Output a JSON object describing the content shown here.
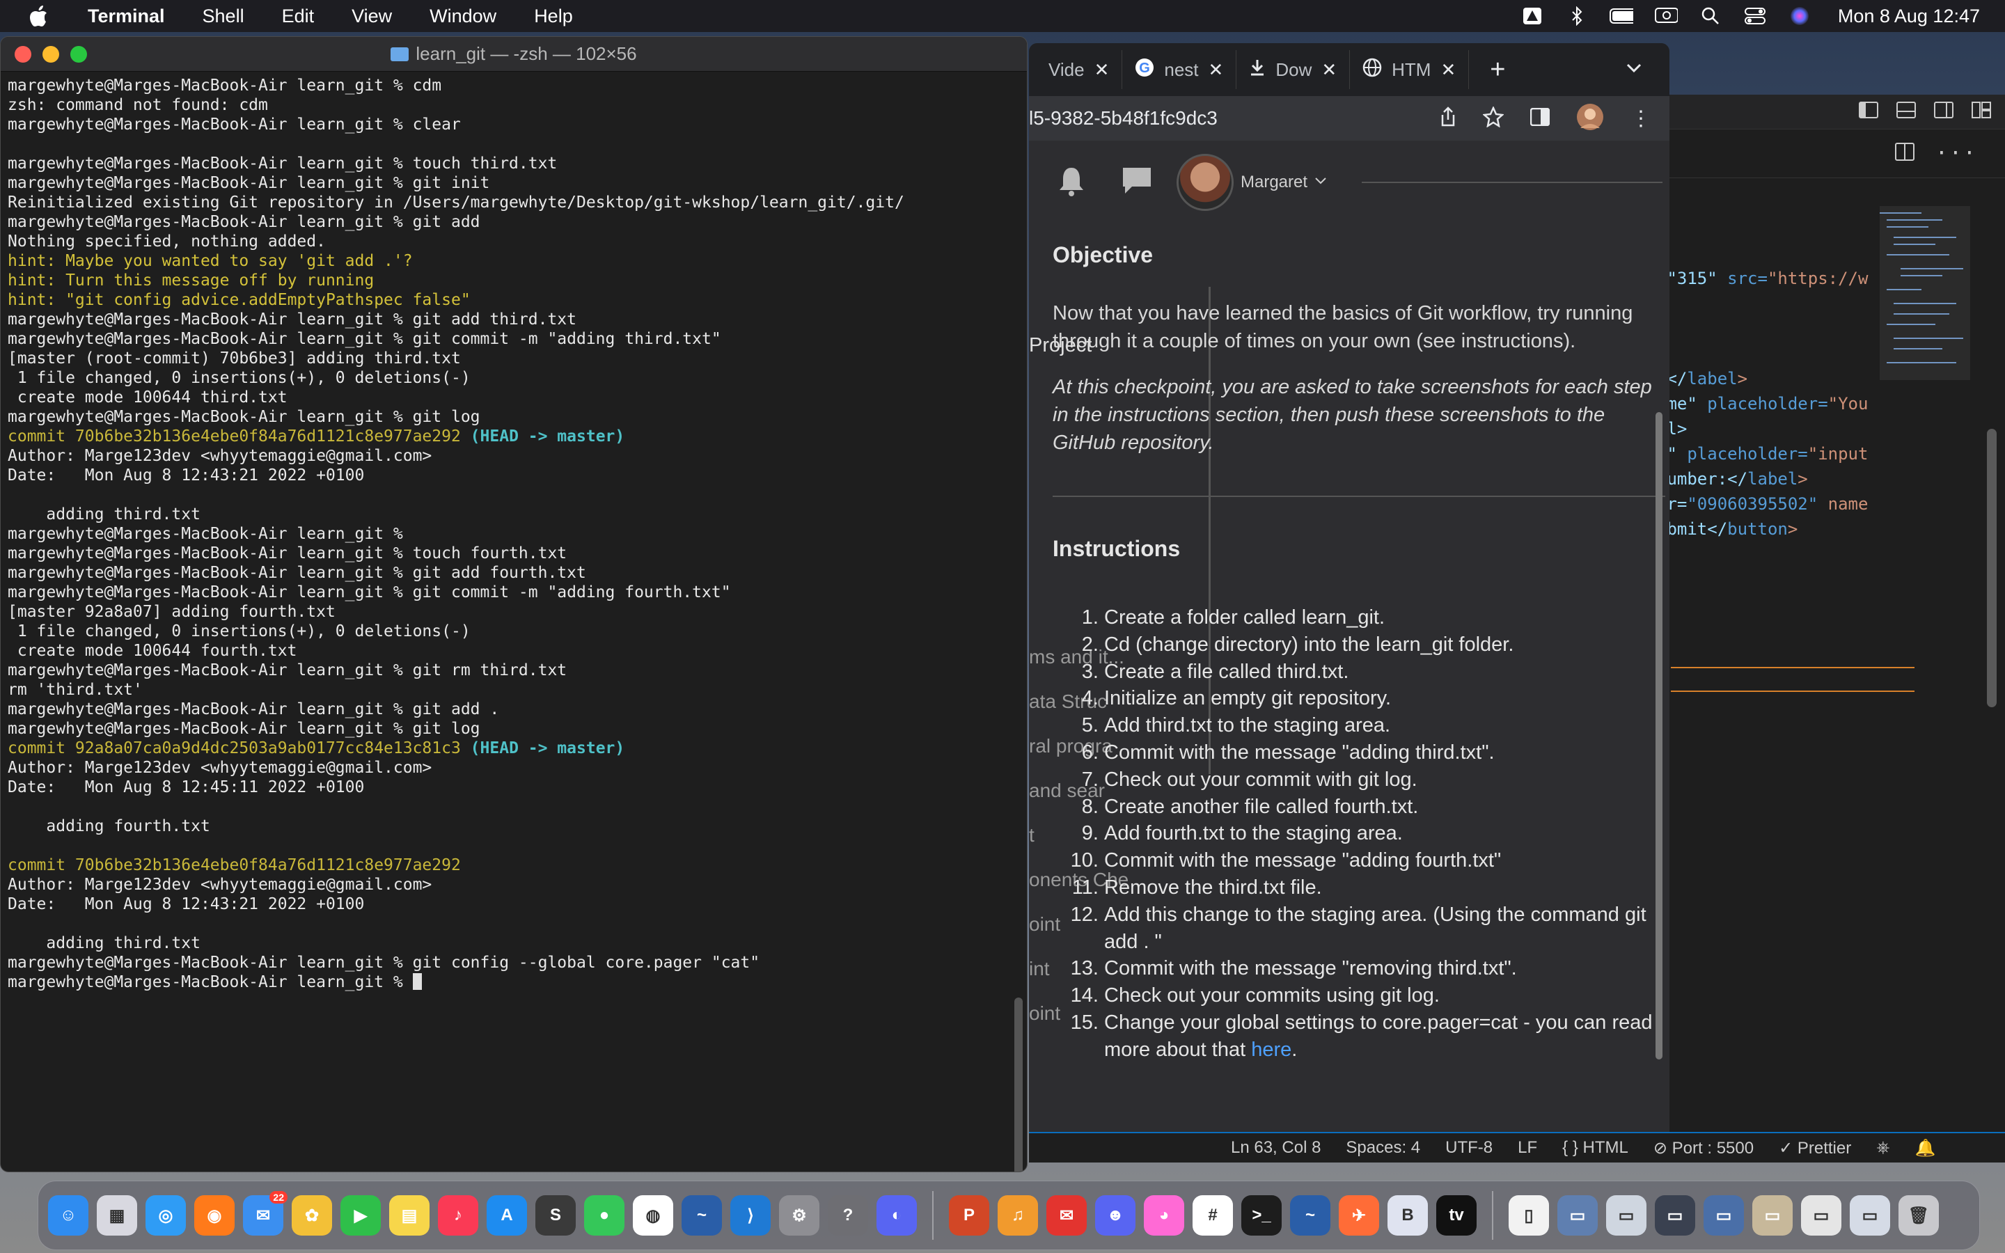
{
  "menubar": {
    "app_name": "Terminal",
    "items": [
      "Shell",
      "Edit",
      "View",
      "Window",
      "Help"
    ],
    "clock": "Mon 8 Aug  12:47"
  },
  "terminal": {
    "title": "learn_git — -zsh — 102×56",
    "lines": [
      {
        "t": "margewhyte@Marges-MacBook-Air learn_git % cdm"
      },
      {
        "t": "zsh: command not found: cdm"
      },
      {
        "t": "margewhyte@Marges-MacBook-Air learn_git % clear"
      },
      {
        "t": ""
      },
      {
        "t": "margewhyte@Marges-MacBook-Air learn_git % touch third.txt"
      },
      {
        "t": "margewhyte@Marges-MacBook-Air learn_git % git init"
      },
      {
        "t": "Reinitialized existing Git repository in /Users/margewhyte/Desktop/git-wkshop/learn_git/.git/"
      },
      {
        "t": "margewhyte@Marges-MacBook-Air learn_git % git add"
      },
      {
        "t": "Nothing specified, nothing added."
      },
      {
        "t": "hint: Maybe you wanted to say 'git add .'?",
        "s": "hint"
      },
      {
        "t": "hint: Turn this message off by running",
        "s": "hint"
      },
      {
        "t": "hint: \"git config advice.addEmptyPathspec false\"",
        "s": "hint"
      },
      {
        "t": "margewhyte@Marges-MacBook-Air learn_git % git add third.txt"
      },
      {
        "t": "margewhyte@Marges-MacBook-Air learn_git % git commit -m \"adding third.txt\""
      },
      {
        "t": "[master (root-commit) 70b6be3] adding third.txt"
      },
      {
        "t": " 1 file changed, 0 insertions(+), 0 deletions(-)"
      },
      {
        "t": " create mode 100644 third.txt"
      },
      {
        "t": "margewhyte@Marges-MacBook-Air learn_git % git log"
      },
      {
        "t": "commit 70b6be32b136e4ebe0f84a76d1121c8e977ae292",
        "s": "commit",
        "head": true
      },
      {
        "t": "Author: Marge123dev <whyytemaggie@gmail.com>"
      },
      {
        "t": "Date:   Mon Aug 8 12:43:21 2022 +0100"
      },
      {
        "t": ""
      },
      {
        "t": "    adding third.txt"
      },
      {
        "t": "margewhyte@Marges-MacBook-Air learn_git %"
      },
      {
        "t": "margewhyte@Marges-MacBook-Air learn_git % touch fourth.txt"
      },
      {
        "t": "margewhyte@Marges-MacBook-Air learn_git % git add fourth.txt"
      },
      {
        "t": "margewhyte@Marges-MacBook-Air learn_git % git commit -m \"adding fourth.txt\""
      },
      {
        "t": "[master 92a8a07] adding fourth.txt"
      },
      {
        "t": " 1 file changed, 0 insertions(+), 0 deletions(-)"
      },
      {
        "t": " create mode 100644 fourth.txt"
      },
      {
        "t": "margewhyte@Marges-MacBook-Air learn_git % git rm third.txt"
      },
      {
        "t": "rm 'third.txt'"
      },
      {
        "t": "margewhyte@Marges-MacBook-Air learn_git % git add ."
      },
      {
        "t": "margewhyte@Marges-MacBook-Air learn_git % git log"
      },
      {
        "t": "commit 92a8a07ca0a9d4dc2503a9ab0177cc84e13c81c3",
        "s": "commit",
        "head": true
      },
      {
        "t": "Author: Marge123dev <whyytemaggie@gmail.com>"
      },
      {
        "t": "Date:   Mon Aug 8 12:45:11 2022 +0100"
      },
      {
        "t": ""
      },
      {
        "t": "    adding fourth.txt"
      },
      {
        "t": ""
      },
      {
        "t": "commit 70b6be32b136e4ebe0f84a76d1121c8e977ae292",
        "s": "commit"
      },
      {
        "t": "Author: Marge123dev <whyytemaggie@gmail.com>"
      },
      {
        "t": "Date:   Mon Aug 8 12:43:21 2022 +0100"
      },
      {
        "t": ""
      },
      {
        "t": "    adding third.txt"
      },
      {
        "t": "margewhyte@Marges-MacBook-Air learn_git % git config --global core.pager \"cat\""
      },
      {
        "t": "margewhyte@Marges-MacBook-Air learn_git % ",
        "cursor": true
      }
    ],
    "head_ref": " (HEAD -> master)"
  },
  "browser": {
    "tabs": [
      {
        "label": "Vide",
        "icon": "video-icon"
      },
      {
        "label": "nest",
        "icon": "google-icon"
      },
      {
        "label": "Dow",
        "icon": "download-icon"
      },
      {
        "label": "HTM",
        "icon": "globe-icon"
      }
    ],
    "url": "l5-9382-5b48f1fc9dc3",
    "user_name": "Margaret",
    "sidebar_fragments": [
      "Project",
      "ms and it...",
      "ata Struc",
      "ral progra",
      "and sear",
      "t",
      "onents Che",
      "oint",
      "int",
      "oint"
    ],
    "objective_heading": "Objective",
    "objective_text": "Now that you have learned the basics of Git workflow, try running through it a couple of times on your own (see instructions).",
    "checkpoint_text": "At this checkpoint, you are asked to take screenshots for each step in the instructions section, then push these screenshots to the GitHub repository.",
    "instructions_heading": "Instructions",
    "instructions": [
      "Create a folder called learn_git.",
      "Cd (change directory) into the learn_git folder.",
      "Create a file called third.txt.",
      "Initialize an empty git repository.",
      "Add third.txt to the staging area.",
      "Commit with the message \"adding third.txt\".",
      "Check out your commit with git log.",
      "Create another file called fourth.txt.",
      "Add fourth.txt to the staging area.",
      "Commit with the message \"adding fourth.txt\"",
      "Remove the third.txt file.",
      "Add this change to the staging area. (Using the command git add . \"",
      "Commit with the message \"removing third.txt\".",
      "Check out your commits using git log.",
      "Change your global settings to core.pager=cat - you can read more about that "
    ],
    "instructions_link": "here",
    "instructions_end": "."
  },
  "editor": {
    "lines": [
      {
        "a": "=\"315\" ",
        "b": "src=",
        "c": "\"https://w"
      },
      {
        "a": "",
        "b": "",
        "c": ""
      },
      {
        "a": "",
        "b": "",
        "c": ""
      },
      {
        "a": "",
        "b": "",
        "c": ""
      },
      {
        "a": ":</",
        "b": "label",
        "c": ">"
      },
      {
        "a": "ame\" ",
        "b": "placeholder=",
        "c": "\"You"
      },
      {
        "a": "el>",
        "b": "",
        "c": ""
      },
      {
        "a": "l\" ",
        "b": "placeholder=",
        "c": "\"input"
      },
      {
        "a": "number:</",
        "b": "label",
        "c": ">"
      },
      {
        "a": "er=",
        "b": "\"09060395502\"",
        "c": " name"
      },
      {
        "a": "ubmit</",
        "b": "button",
        "c": ">"
      }
    ]
  },
  "statusbar": {
    "position": "Ln 63, Col 8",
    "spaces": "Spaces: 4",
    "encoding": "UTF-8",
    "eol": "LF",
    "language": "HTML",
    "port": "Port : 5500",
    "formatter": "Prettier"
  },
  "dock": {
    "mail_badge": "22",
    "apps": [
      {
        "name": "finder-icon",
        "bg": "#2f8cf0",
        "glyph": "☺"
      },
      {
        "name": "launchpad-icon",
        "bg": "#d8d8e0",
        "glyph": "▦"
      },
      {
        "name": "safari-icon",
        "bg": "#2f9cf5",
        "glyph": "◎"
      },
      {
        "name": "firefox-icon",
        "bg": "#ff7a1a",
        "glyph": "◉"
      },
      {
        "name": "mail-icon",
        "bg": "#3b8ff0",
        "glyph": "✉"
      },
      {
        "name": "photos-icon",
        "bg": "#f3c037",
        "glyph": "✿"
      },
      {
        "name": "facetime-icon",
        "bg": "#2fbf4a",
        "glyph": "▶"
      },
      {
        "name": "notes-icon",
        "bg": "#f7d64a",
        "glyph": "▤"
      },
      {
        "name": "music-icon",
        "bg": "#fa3a55",
        "glyph": "♪"
      },
      {
        "name": "app-store-icon",
        "bg": "#1e8cf0",
        "glyph": "A"
      },
      {
        "name": "sublime-icon",
        "bg": "#3a3a3a",
        "glyph": "S"
      },
      {
        "name": "messages-icon",
        "bg": "#35c759",
        "glyph": "●"
      },
      {
        "name": "chrome-icon",
        "bg": "#ffffff",
        "glyph": "◍"
      },
      {
        "name": "wireshark-icon",
        "bg": "#2a5ea8",
        "glyph": "~"
      },
      {
        "name": "vscode-icon",
        "bg": "#1f7ad4",
        "glyph": "⟩"
      },
      {
        "name": "system-preferences-icon",
        "bg": "#8e8e93",
        "glyph": "⚙"
      },
      {
        "name": "help-icon",
        "bg": "#6e6e73",
        "glyph": "?"
      },
      {
        "name": "discord-dock-icon",
        "bg": "#5865f2",
        "glyph": "◐"
      },
      {
        "name": "sep",
        "bg": "",
        "glyph": ""
      },
      {
        "name": "powerpoint-icon",
        "bg": "#d24726",
        "glyph": "P"
      },
      {
        "name": "garageband-icon",
        "bg": "#f19a2d",
        "glyph": "♫"
      },
      {
        "name": "email-client-icon",
        "bg": "#e3342f",
        "glyph": "✉"
      },
      {
        "name": "discord-icon",
        "bg": "#5865f2",
        "glyph": "☻"
      },
      {
        "name": "color-picker-icon",
        "bg": "#ff6ad5",
        "glyph": "◕"
      },
      {
        "name": "slack-icon",
        "bg": "#ffffff",
        "glyph": "#"
      },
      {
        "name": "terminal-icon",
        "bg": "#1d1d1d",
        "glyph": ">_"
      },
      {
        "name": "wireshark-2-icon",
        "bg": "#2a5ea8",
        "glyph": "~"
      },
      {
        "name": "postman-icon",
        "bg": "#ff6c37",
        "glyph": "✈"
      },
      {
        "name": "bbedit-icon",
        "bg": "#dfe3f0",
        "glyph": "B"
      },
      {
        "name": "apple-tv-icon",
        "bg": "#111111",
        "glyph": "tv"
      },
      {
        "name": "sep",
        "bg": "",
        "glyph": ""
      },
      {
        "name": "document-icon",
        "bg": "#f2f2f2",
        "glyph": "▯"
      },
      {
        "name": "folder-stack-icon",
        "bg": "#5f7fb0",
        "glyph": "▭"
      },
      {
        "name": "screenshot-stack-1-icon",
        "bg": "#cfd6e0",
        "glyph": "▭"
      },
      {
        "name": "screenshot-stack-2-icon",
        "bg": "#3a4150",
        "glyph": "▭"
      },
      {
        "name": "screenshot-stack-3-icon",
        "bg": "#4a6fa8",
        "glyph": "▭"
      },
      {
        "name": "screenshot-stack-4-icon",
        "bg": "#c7b89a",
        "glyph": "▭"
      },
      {
        "name": "screenshot-stack-5-icon",
        "bg": "#e5e5e5",
        "glyph": "▭"
      },
      {
        "name": "screenshot-stack-6-icon",
        "bg": "#d5dbe6",
        "glyph": "▭"
      },
      {
        "name": "trash-icon",
        "bg": "#c8c8cc",
        "glyph": "🗑"
      }
    ]
  }
}
